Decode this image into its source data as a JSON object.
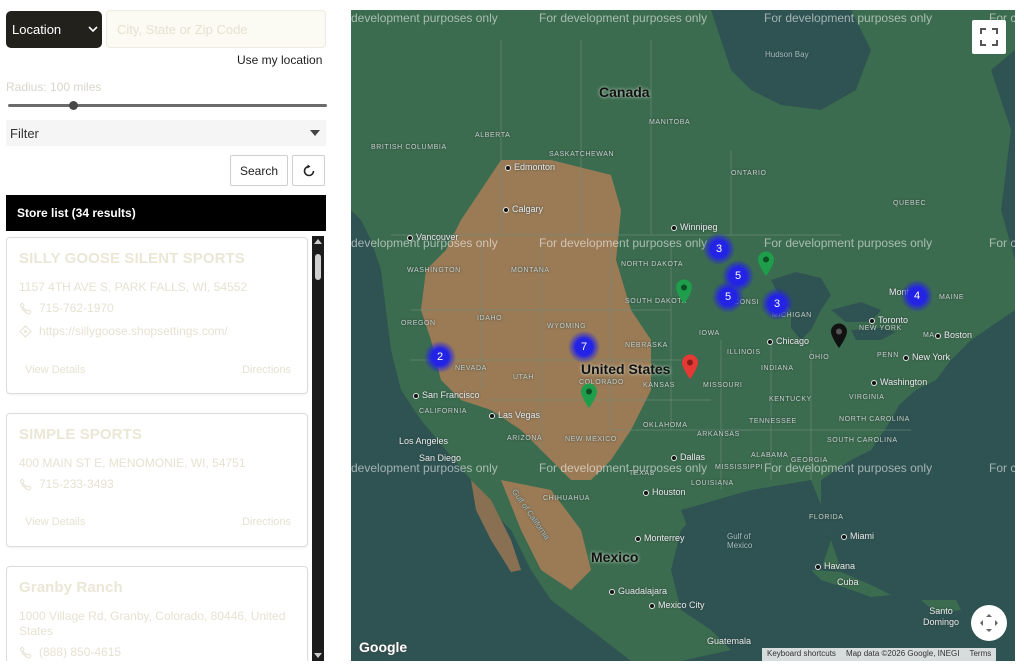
{
  "search": {
    "location_select": "Location",
    "location_placeholder": "City, State or Zip Code",
    "use_my_location": "Use my location",
    "radius_label": "Radius:  100 miles",
    "radius_value_miles": 100,
    "filter_label": "Filter",
    "search_button": "Search",
    "reset_icon": "refresh-icon"
  },
  "list": {
    "header": "Store list (34 results)",
    "stores": [
      {
        "name": "SILLY GOOSE SILENT SPORTS",
        "address": "1157 4TH AVE S, PARK FALLS, WI, 54552",
        "phone": "715-762-1970",
        "website": "https://sillygoose.shopsettings.com/",
        "view_details": "View Details",
        "directions": "Directions"
      },
      {
        "name": "SIMPLE SPORTS",
        "address": "400 MAIN ST E, MENOMONIE, WI, 54751",
        "phone": "715-233-3493",
        "view_details": "View Details",
        "directions": "Directions"
      },
      {
        "name": "Granby Ranch",
        "address": "1000 Village Rd, Granby, Colorado, 80446, United States",
        "phone": "(888) 850-4615"
      }
    ]
  },
  "map": {
    "watermark": "For development purposes only",
    "watermark_left": "development purposes only",
    "watermark_right": "For c",
    "country_labels": [
      "Canada",
      "United States",
      "Mexico"
    ],
    "labels": {
      "hudson_bay": "Hudson Bay",
      "british_columbia": "BRITISH COLUMBIA",
      "alberta": "ALBERTA",
      "saskatchewan": "SASKATCHEWAN",
      "manitoba": "MANITOBA",
      "ontario": "ONTARIO",
      "quebec": "QUEBEC",
      "edmonton": "Edmonton",
      "calgary": "Calgary",
      "vancouver": "Vancouver",
      "winnipeg": "Winnipeg",
      "washington": "WASHINGTON",
      "montana": "MONTANA",
      "north_dakota": "NORTH DAKOTA",
      "oregon": "OREGON",
      "idaho": "IDAHO",
      "south_dakota": "SOUTH DAKOTA",
      "wyoming": "WYOMING",
      "nebraska": "NEBRASKA",
      "nevada": "NEVADA",
      "utah": "UTAH",
      "colorado": "COLORADO",
      "kansas": "KANSAS",
      "missouri": "MISSOURI",
      "iowa": "IOWA",
      "illinois": "ILLINOIS",
      "indiana": "INDIANA",
      "ohio": "OHIO",
      "michigan": "MICHIGAN",
      "wisconsin": "CONSI",
      "penn": "PENN",
      "new_york_state": "NEW YORK",
      "maine": "MAINE",
      "ma": "MA",
      "california": "CALIFORNIA",
      "arizona": "ARIZONA",
      "new_mexico": "NEW MEXICO",
      "oklahoma": "OKLAHOMA",
      "arkansas": "ARKANSAS",
      "tennessee": "TENNESSEE",
      "kentucky": "KENTUCKY",
      "virginia": "VIRGINIA",
      "north_carolina": "NORTH CAROLINA",
      "south_carolina": "SOUTH CAROLINA",
      "georgia": "GEORGIA",
      "alabama": "ALABAMA",
      "mississippi": "MISSISSIPPI",
      "louisiana": "LOUISIANA",
      "texas": "TEXAS",
      "florida": "FLORIDA",
      "chihuahua": "CHIHUAHUA",
      "gulf_california": "Gulf of California",
      "gulf_mexico": "Gulf of Mexico",
      "san_francisco": "San Francisco",
      "las_vegas": "Las Vegas",
      "los_angeles": "Los Angeles",
      "san_diego": "San Diego",
      "chicago": "Chicago",
      "toronto": "Toronto",
      "montreal": "Montreal",
      "boston": "Boston",
      "new_york": "New York",
      "washington_dc": "Washington",
      "dallas": "Dallas",
      "houston": "Houston",
      "miami": "Miami",
      "havana": "Havana",
      "cuba": "Cuba",
      "monterrey": "Monterrey",
      "guadalajara": "Guadalajara",
      "mexico_city": "Mexico City",
      "guatemala": "Guatemala",
      "santo_domingo": "Santo\nDomingo"
    },
    "clusters": [
      {
        "count": "2"
      },
      {
        "count": "7"
      },
      {
        "count": "3"
      },
      {
        "count": "5"
      },
      {
        "count": "5"
      },
      {
        "count": "3"
      },
      {
        "count": "4"
      }
    ],
    "pins": [
      {
        "color": "#1e9e4a"
      },
      {
        "color": "#1e9e4a"
      },
      {
        "color": "#1e9e4a"
      },
      {
        "color": "#e53935"
      },
      {
        "color": "#111111"
      }
    ],
    "google_logo": "Google",
    "attribution": [
      "Keyboard shortcuts",
      "Map data ©2026 Google, INEGI",
      "Terms"
    ],
    "fullscreen_icon": "fullscreen-icon",
    "camera_control_icon": "map-camera-control-icon",
    "colors": {
      "water": "#2f5352",
      "land_green": "#3c6c4f",
      "land_tan": "#9b7b56",
      "cluster": "#2323e6"
    }
  }
}
